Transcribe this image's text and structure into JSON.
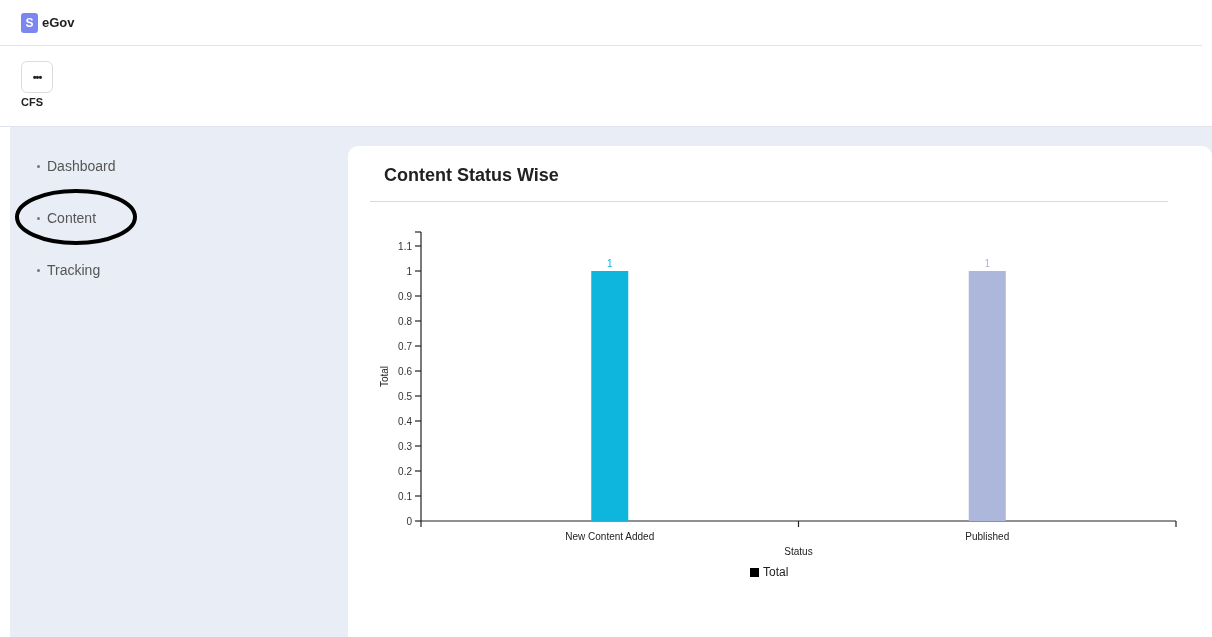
{
  "header": {
    "logo_letter": "S",
    "brand": "eGov"
  },
  "app_switcher": {
    "icon": "•••",
    "label": "CFS"
  },
  "sidebar": {
    "items": [
      {
        "label": "Dashboard",
        "circled": false
      },
      {
        "label": "Content",
        "circled": true
      },
      {
        "label": "Tracking",
        "circled": false
      }
    ]
  },
  "card": {
    "title": "Content Status Wise",
    "chart_data": {
      "type": "bar",
      "xlabel": "Status",
      "ylabel": "Total",
      "categories": [
        "New Content Added",
        "Published"
      ],
      "series": [
        {
          "color": "#0eb5dc",
          "values": [
            1,
            null
          ]
        },
        {
          "color": "#adb7dc",
          "values": [
            null,
            1
          ]
        }
      ],
      "ylim": [
        0,
        1.156
      ],
      "yticks": [
        0,
        0.1,
        0.2,
        0.3,
        0.4,
        0.5,
        0.6,
        0.7,
        0.8,
        0.9,
        1,
        1.1
      ],
      "data_labels": true
    },
    "legend": {
      "label": "Total",
      "color": "#000000"
    }
  }
}
